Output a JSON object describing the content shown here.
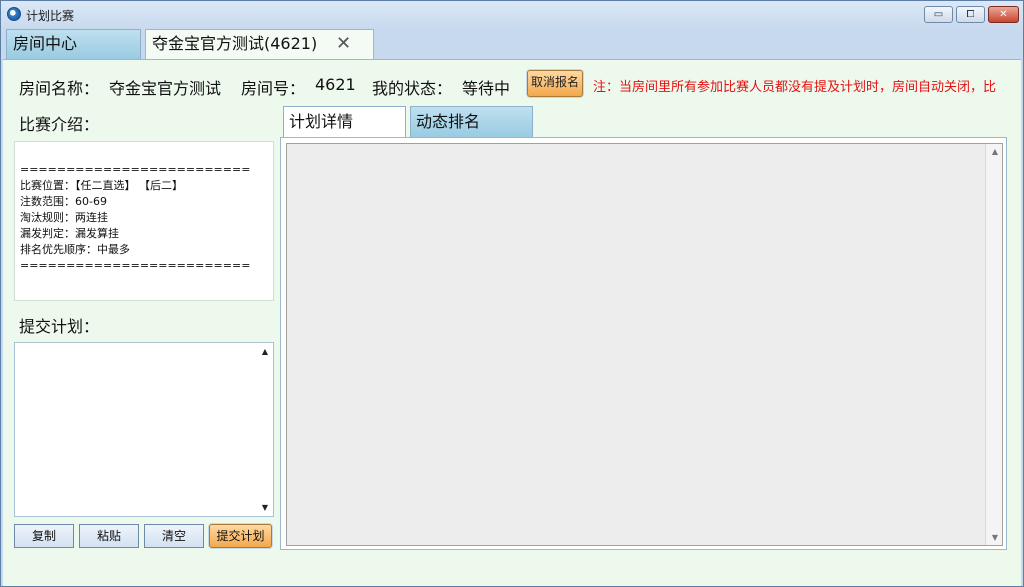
{
  "window": {
    "title": "计划比赛",
    "controls": {
      "minimize": "▭",
      "maximize": "⧠",
      "close": "✕"
    }
  },
  "top_tabs": [
    {
      "label": "房间中心"
    },
    {
      "label": "夺金宝官方测试(4621)",
      "close_glyph": "✕"
    }
  ],
  "room_info": {
    "name_label": "房间名称：",
    "name_value": "夺金宝官方测试",
    "number_label": "房间号：",
    "number_value": "4621",
    "status_label": "我的状态：",
    "status_value": "等待中",
    "cancel_button": "取消报名",
    "note": "注：当房间里所有参加比赛人员都没有提及计划时，房间自动关闭，比"
  },
  "intro": {
    "label": "比赛介绍：",
    "text": "=========================\n比赛位置：【任二直选】 【后二】\n注数范围：60-69\n淘汰规则：两连挂\n漏发判定：漏发算挂\n排名优先顺序：中最多\n========================="
  },
  "plan": {
    "label": "提交计划：",
    "value": "",
    "buttons": {
      "copy": "复制",
      "paste": "粘贴",
      "clear": "清空",
      "submit": "提交计划"
    }
  },
  "right_tabs": [
    {
      "label": "计划详情"
    },
    {
      "label": "动态排名"
    }
  ],
  "scroll": {
    "up": "▲",
    "down": "▼"
  },
  "colors": {
    "accent_button": "#f2a84c",
    "note_text": "#e21212",
    "tab_active_bg": "#ffffff",
    "tab_inactive_bg": "#99cbe2"
  }
}
